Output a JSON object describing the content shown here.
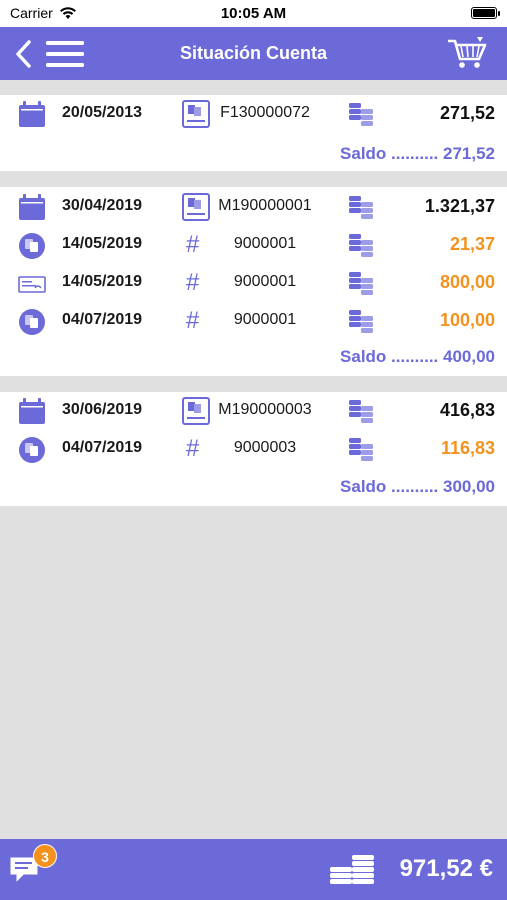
{
  "status": {
    "carrier": "Carrier",
    "time": "10:05 AM"
  },
  "nav": {
    "title": "Situación Cuenta"
  },
  "groups": [
    {
      "rows": [
        {
          "icon": "calendar-icon",
          "date": "20/05/2013",
          "ref_icon": "invoice-icon",
          "ref": "F130000072",
          "amount": "271,52",
          "amount_color": "#111111"
        }
      ],
      "saldo": "Saldo .......... 271,52"
    },
    {
      "rows": [
        {
          "icon": "calendar-icon",
          "date": "30/04/2019",
          "ref_icon": "invoice-icon",
          "ref": "M190000001",
          "amount": "1.321,37",
          "amount_color": "#111111"
        },
        {
          "icon": "payment-circle-icon",
          "date": "14/05/2019",
          "ref_icon": "hash-icon",
          "ref": "9000001",
          "amount": "21,37",
          "amount_color": "#f5921e"
        },
        {
          "icon": "check-icon",
          "date": "14/05/2019",
          "ref_icon": "hash-icon",
          "ref": "9000001",
          "amount": "800,00",
          "amount_color": "#f5921e"
        },
        {
          "icon": "payment-circle-icon",
          "date": "04/07/2019",
          "ref_icon": "hash-icon",
          "ref": "9000001",
          "amount": "100,00",
          "amount_color": "#f5921e"
        }
      ],
      "saldo": "Saldo .......... 400,00"
    },
    {
      "rows": [
        {
          "icon": "calendar-icon",
          "date": "30/06/2019",
          "ref_icon": "invoice-icon",
          "ref": "M190000003",
          "amount": "416,83",
          "amount_color": "#111111"
        },
        {
          "icon": "payment-circle-icon",
          "date": "04/07/2019",
          "ref_icon": "hash-icon",
          "ref": "9000003",
          "amount": "116,83",
          "amount_color": "#f5921e"
        }
      ],
      "saldo": "Saldo .......... 300,00"
    }
  ],
  "footer": {
    "badge": "3",
    "total": "971,52 €"
  },
  "colors": {
    "accent": "#6b6ad8",
    "orange": "#f5921e"
  }
}
